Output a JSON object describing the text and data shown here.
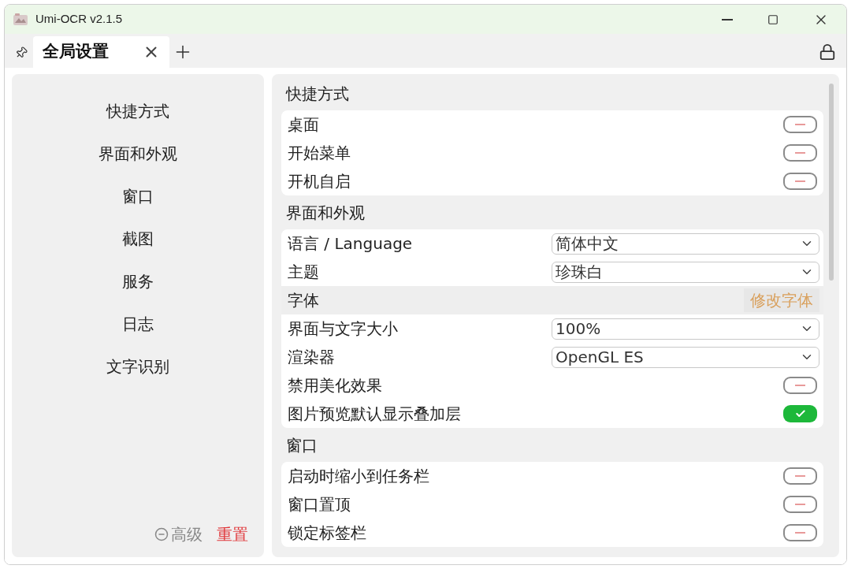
{
  "window": {
    "title": "Umi-OCR v2.1.5"
  },
  "tab_bar": {
    "tabs": [
      {
        "label": "全局设置",
        "selected": true
      }
    ]
  },
  "sidebar": {
    "items": [
      {
        "label": "快捷方式"
      },
      {
        "label": "界面和外观"
      },
      {
        "label": "窗口"
      },
      {
        "label": "截图"
      },
      {
        "label": "服务"
      },
      {
        "label": "日志"
      },
      {
        "label": "文字识别"
      }
    ],
    "footer": {
      "advanced": "高级",
      "reset": "重置"
    }
  },
  "settings": {
    "sections": [
      {
        "title": "快捷方式",
        "rows": [
          {
            "kind": "toggle",
            "label": "桌面",
            "on": false
          },
          {
            "kind": "toggle",
            "label": "开始菜单",
            "on": false
          },
          {
            "kind": "toggle",
            "label": "开机自启",
            "on": false
          }
        ]
      },
      {
        "title": "界面和外观",
        "rows": [
          {
            "kind": "select",
            "label": "语言 / Language",
            "value": "简体中文"
          },
          {
            "kind": "select",
            "label": "主题",
            "value": "珍珠白"
          },
          {
            "kind": "subheader",
            "label": "字体",
            "button": "修改字体"
          },
          {
            "kind": "select",
            "label": "界面与文字大小",
            "value": "100%"
          },
          {
            "kind": "select",
            "label": "渲染器",
            "value": "OpenGL ES"
          },
          {
            "kind": "toggle",
            "label": "禁用美化效果",
            "on": false
          },
          {
            "kind": "toggle",
            "label": "图片预览默认显示叠加层",
            "on": true
          }
        ]
      },
      {
        "title": "窗口",
        "rows": [
          {
            "kind": "toggle",
            "label": "启动时缩小到任务栏",
            "on": false
          },
          {
            "kind": "toggle",
            "label": "窗口置顶",
            "on": false
          },
          {
            "kind": "toggle",
            "label": "锁定标签栏",
            "on": false
          }
        ]
      }
    ]
  }
}
